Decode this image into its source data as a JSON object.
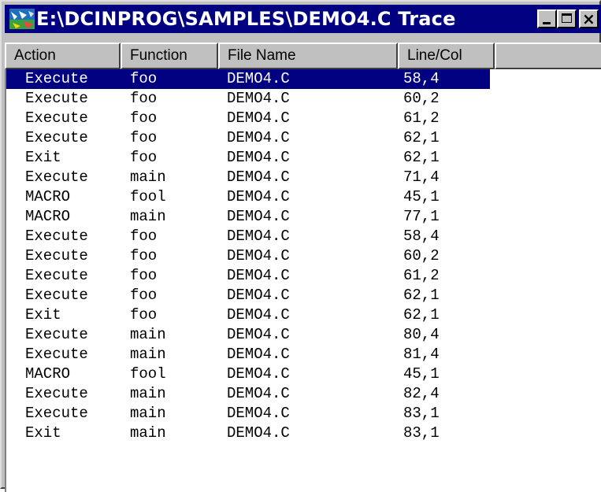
{
  "window": {
    "title": "E:\\DCINPROG\\SAMPLES\\DEMO4.C Trace"
  },
  "columns": [
    "Action",
    "Function",
    "File Name",
    "Line/Col"
  ],
  "rows": [
    {
      "action": "Execute",
      "function": "foo",
      "file": "DEMO4.C",
      "linecol": "58,4",
      "selected": true
    },
    {
      "action": "Execute",
      "function": "foo",
      "file": "DEMO4.C",
      "linecol": "60,2"
    },
    {
      "action": "Execute",
      "function": "foo",
      "file": "DEMO4.C",
      "linecol": "61,2"
    },
    {
      "action": "Execute",
      "function": "foo",
      "file": "DEMO4.C",
      "linecol": "62,1"
    },
    {
      "action": "Exit",
      "function": "foo",
      "file": "DEMO4.C",
      "linecol": "62,1"
    },
    {
      "action": "Execute",
      "function": "main",
      "file": "DEMO4.C",
      "linecol": "71,4"
    },
    {
      "action": "MACRO",
      "function": "fool",
      "file": "DEMO4.C",
      "linecol": "45,1"
    },
    {
      "action": "MACRO",
      "function": "main",
      "file": "DEMO4.C",
      "linecol": "77,1"
    },
    {
      "action": "Execute",
      "function": "foo",
      "file": "DEMO4.C",
      "linecol": "58,4"
    },
    {
      "action": "Execute",
      "function": "foo",
      "file": "DEMO4.C",
      "linecol": "60,2"
    },
    {
      "action": "Execute",
      "function": "foo",
      "file": "DEMO4.C",
      "linecol": "61,2"
    },
    {
      "action": "Execute",
      "function": "foo",
      "file": "DEMO4.C",
      "linecol": "62,1"
    },
    {
      "action": "Exit",
      "function": "foo",
      "file": "DEMO4.C",
      "linecol": "62,1"
    },
    {
      "action": "Execute",
      "function": "main",
      "file": "DEMO4.C",
      "linecol": "80,4"
    },
    {
      "action": "Execute",
      "function": "main",
      "file": "DEMO4.C",
      "linecol": "81,4"
    },
    {
      "action": "MACRO",
      "function": "fool",
      "file": "DEMO4.C",
      "linecol": "45,1"
    },
    {
      "action": "Execute",
      "function": "main",
      "file": "DEMO4.C",
      "linecol": "82,4"
    },
    {
      "action": "Execute",
      "function": "main",
      "file": "DEMO4.C",
      "linecol": "83,1"
    },
    {
      "action": "Exit",
      "function": "main",
      "file": "DEMO4.C",
      "linecol": "83,1"
    }
  ],
  "colors": {
    "titlebar": "#000080",
    "selection": "#000080",
    "face": "#c0c0c0"
  },
  "icons": {
    "app": "dcinprog-app-icon",
    "minimize": "minimize-icon",
    "maximize": "maximize-icon",
    "close": "close-icon"
  }
}
